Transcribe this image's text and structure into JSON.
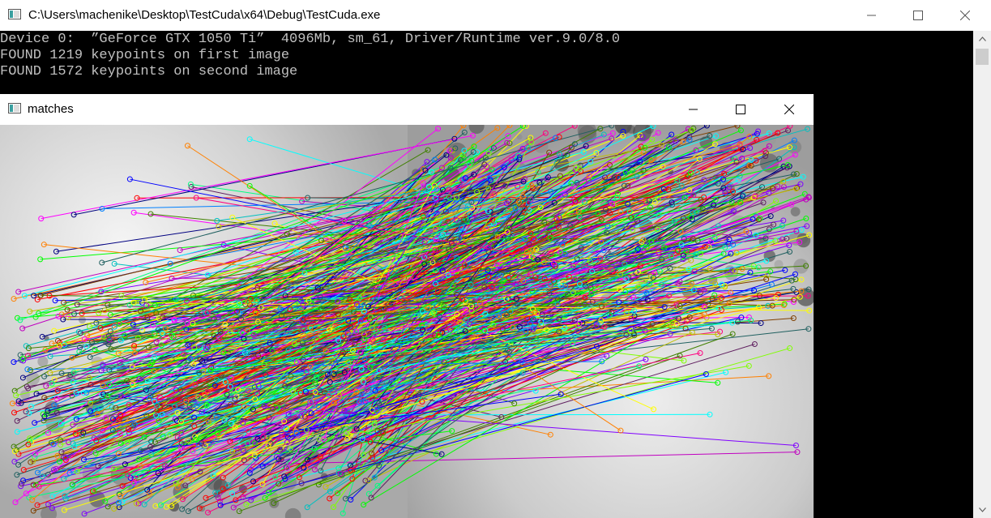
{
  "console": {
    "title": "C:\\Users\\machenike\\Desktop\\TestCuda\\x64\\Debug\\TestCuda.exe",
    "lines": [
      "Device 0:  ”GeForce GTX 1050 Ti”  4096Mb, sm_61, Driver/Runtime ver.9.0/8.0",
      "FOUND 1219 keypoints on first image",
      "FOUND 1572 keypoints on second image"
    ]
  },
  "matches_window": {
    "title": "matches"
  },
  "icons": {
    "app": "console-window-icon",
    "minimize": "minimize-icon",
    "maximize": "maximize-icon",
    "close": "close-icon"
  },
  "colors": {
    "console_bg": "#000000",
    "console_text": "#c0c0c0",
    "titlebar_bg": "#ffffff"
  }
}
